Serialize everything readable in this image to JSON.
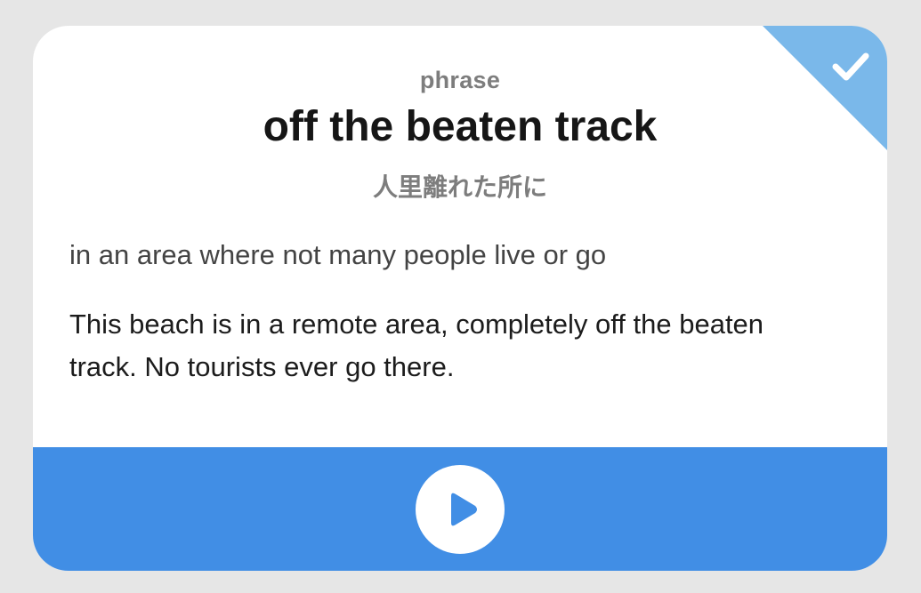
{
  "card": {
    "type_label": "phrase",
    "headword": "off the beaten track",
    "translation": "人里離れた所に",
    "definition": "in an area where not many people live or go",
    "example": "This beach is in a remote area, completely off the beaten track. No tourists ever go there."
  },
  "icons": {
    "corner": "checkmark-icon",
    "play": "play-icon"
  },
  "colors": {
    "background": "#e6e6e6",
    "card": "#ffffff",
    "corner_flag": "#7ab8ea",
    "footer_bar": "#418ee5",
    "play_glyph": "#418ee5"
  }
}
